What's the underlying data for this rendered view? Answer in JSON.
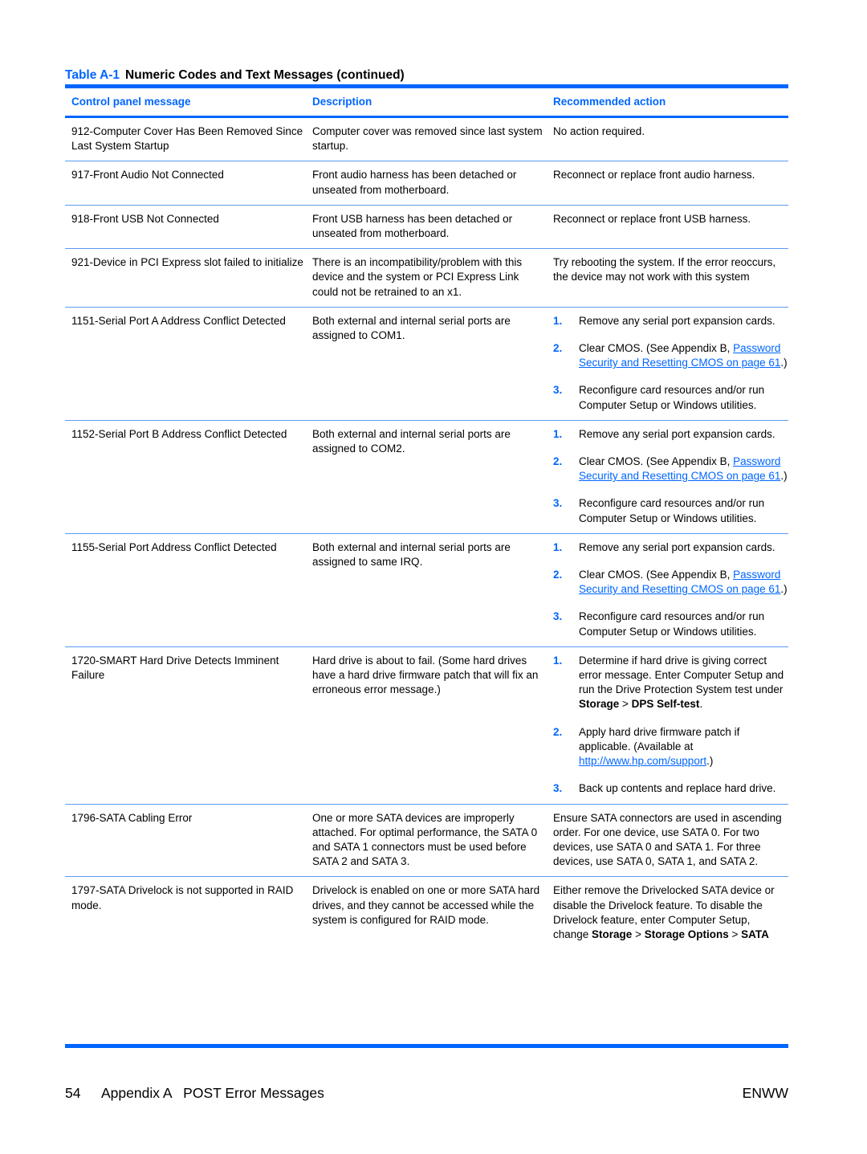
{
  "table": {
    "number": "Table A-1",
    "title": "Numeric Codes and Text Messages (continued)",
    "columns": [
      "Control panel message",
      "Description",
      "Recommended action"
    ],
    "rows": [
      {
        "message": "912-Computer Cover Has Been Removed Since Last System Startup",
        "description": "Computer cover was removed since last system startup.",
        "action": "No action required."
      },
      {
        "message": "917-Front Audio Not Connected",
        "description": "Front audio harness has been detached or unseated from motherboard.",
        "action": "Reconnect or replace front audio harness."
      },
      {
        "message": "918-Front USB Not Connected",
        "description": "Front USB harness has been detached or unseated from motherboard.",
        "action": "Reconnect or replace front USB harness."
      },
      {
        "message": "921-Device in PCI Express slot failed to initialize",
        "description": "There is an incompatibility/problem with this device and the system or PCI Express Link could not be retrained to an x1.",
        "action": "Try rebooting the system. If the error reoccurs, the device may not work with this system"
      },
      {
        "message": "1151-Serial Port A Address Conflict Detected",
        "description": "Both external and internal serial ports are assigned to COM1.",
        "steps": [
          {
            "num": "1.",
            "text": "Remove any serial port expansion cards."
          },
          {
            "num": "2.",
            "pre": "Clear CMOS. (See Appendix B, ",
            "link": "Password Security and Resetting CMOS on page 61",
            "post": ".)"
          },
          {
            "num": "3.",
            "text": "Reconfigure card resources and/or run Computer Setup or Windows utilities."
          }
        ]
      },
      {
        "message": "1152-Serial Port B Address Conflict Detected",
        "description": "Both external and internal serial ports are assigned to COM2.",
        "steps": [
          {
            "num": "1.",
            "text": "Remove any serial port expansion cards."
          },
          {
            "num": "2.",
            "pre": "Clear CMOS. (See Appendix B, ",
            "link": "Password Security and Resetting CMOS on page 61",
            "post": ".)"
          },
          {
            "num": "3.",
            "text": "Reconfigure card resources and/or run Computer Setup or Windows utilities."
          }
        ]
      },
      {
        "message": "1155-Serial Port Address Conflict Detected",
        "description": "Both external and internal serial ports are assigned to same IRQ.",
        "steps": [
          {
            "num": "1.",
            "text": "Remove any serial port expansion cards."
          },
          {
            "num": "2.",
            "pre": "Clear CMOS. (See Appendix B, ",
            "link": "Password Security and Resetting CMOS on page 61",
            "post": ".)"
          },
          {
            "num": "3.",
            "text": "Reconfigure card resources and/or run Computer Setup or Windows utilities."
          }
        ]
      },
      {
        "message": "1720-SMART Hard Drive Detects Imminent Failure",
        "description": "Hard drive is about to fail. (Some hard drives have a hard drive firmware patch that will fix an erroneous error message.)",
        "steps": [
          {
            "num": "1.",
            "pre": "Determine if hard drive is giving correct error message. Enter Computer Setup and run the Drive Protection System test under ",
            "bold1": "Storage",
            "sep": " > ",
            "bold2": "DPS Self-test",
            "post": "."
          },
          {
            "num": "2.",
            "pre": "Apply hard drive firmware patch if applicable. (Available at ",
            "link": "http://www.hp.com/support",
            "post": ".)"
          },
          {
            "num": "3.",
            "text": "Back up contents and replace hard drive."
          }
        ]
      },
      {
        "message": "1796-SATA Cabling Error",
        "description": "One or more SATA devices are improperly attached. For optimal performance, the SATA 0 and SATA 1 connectors must be used before SATA 2 and SATA 3.",
        "action": "Ensure SATA connectors are used in ascending order. For one device, use SATA 0. For two devices, use SATA 0 and SATA 1. For three devices, use SATA 0, SATA 1, and SATA 2."
      },
      {
        "message": "1797-SATA Drivelock is not supported in RAID mode.",
        "description": "Drivelock is enabled on one or more SATA hard drives, and they cannot be accessed while the system is configured for RAID mode.",
        "action_pre": "Either remove the Drivelocked SATA device or disable the Drivelock feature. To disable the Drivelock feature, enter Computer Setup, change ",
        "action_b1": "Storage",
        "action_sep1": " > ",
        "action_b2": "Storage Options",
        "action_sep2": " > ",
        "action_b3": "SATA"
      }
    ]
  },
  "footer": {
    "page_number": "54",
    "section": "Appendix A   POST Error Messages",
    "right_label": "ENWW"
  },
  "colors": {
    "accent": "#0066ff",
    "row_rule": "#5b9bf5"
  }
}
